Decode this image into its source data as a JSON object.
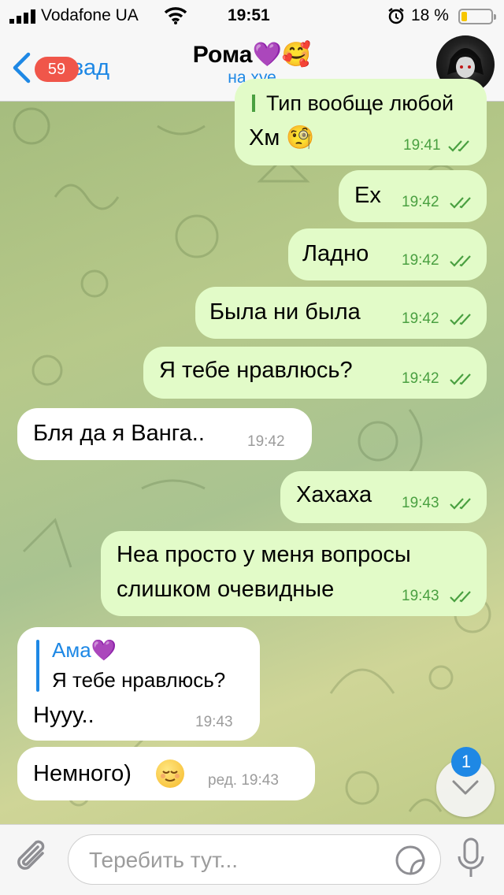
{
  "status": {
    "carrier": "Vodafone UA",
    "time": "19:51",
    "battery_percent": "18 %",
    "battery_level": 0.18
  },
  "header": {
    "back_label": "Назад",
    "unread_badge": "59",
    "title": "Рома💜🥰",
    "subtitle": "на хуе"
  },
  "messages": [
    {
      "dir": "out",
      "partial": "Тип вообще любой",
      "text": "Хм 🧐",
      "time": "19:41"
    },
    {
      "dir": "out",
      "text": "Ех",
      "time": "19:42"
    },
    {
      "dir": "out",
      "text": "Ладно",
      "time": "19:42"
    },
    {
      "dir": "out",
      "text": "Была ни была",
      "time": "19:42"
    },
    {
      "dir": "out",
      "text": "Я тебе нравлюсь?",
      "time": "19:42"
    },
    {
      "dir": "in",
      "text": "Бля да я Ванга..",
      "time": "19:42"
    },
    {
      "dir": "out",
      "text": "Хахаха",
      "time": "19:43"
    },
    {
      "dir": "out",
      "line1": "Неа просто у меня вопросы",
      "line2": "слишком очевидные",
      "time": "19:43"
    },
    {
      "dir": "in",
      "reply_author": "Ама💜",
      "reply_text": "Я тебе нравлюсь?",
      "text": "Нууу..",
      "time": "19:43"
    },
    {
      "dir": "in",
      "text": "Немного)",
      "time": "ред. 19:43"
    }
  ],
  "scroll_down_badge": "1",
  "input": {
    "placeholder": "Теребить тут..."
  },
  "icons": [
    "signal-icon",
    "wifi-icon",
    "alarm-icon",
    "battery-icon",
    "back-chevron-icon",
    "attach-icon",
    "sticker-icon",
    "mic-icon",
    "chevron-down-icon",
    "double-check-icon"
  ],
  "colors": {
    "accent": "#1e88e5",
    "outgoing_bubble": "#e2fbc8",
    "incoming_bubble": "#ffffff",
    "badge": "#f0564a",
    "check_green": "#4aa041"
  }
}
